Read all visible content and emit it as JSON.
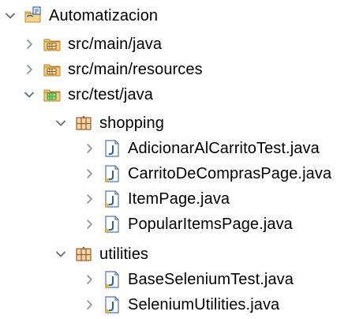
{
  "tree": {
    "project": {
      "label": "Automatizacion",
      "expanded": true,
      "icon": "java-project-icon"
    },
    "source_folders": [
      {
        "label": "src/main/java",
        "expanded": false,
        "icon": "source-folder-icon"
      },
      {
        "label": "src/main/resources",
        "expanded": false,
        "icon": "source-folder-icon"
      },
      {
        "label": "src/test/java",
        "expanded": true,
        "icon": "test-source-folder-icon"
      }
    ],
    "packages": [
      {
        "label": "shopping",
        "expanded": true,
        "icon": "package-icon",
        "files": [
          {
            "label": "AdicionarAlCarritoTest.java",
            "icon": "java-file-icon"
          },
          {
            "label": "CarritoDeComprasPage.java",
            "icon": "java-file-icon"
          },
          {
            "label": "ItemPage.java",
            "icon": "java-file-icon"
          },
          {
            "label": "PopularItemsPage.java",
            "icon": "java-file-icon"
          }
        ]
      },
      {
        "label": "utilities",
        "expanded": true,
        "icon": "package-icon",
        "files": [
          {
            "label": "BaseSeleniumTest.java",
            "icon": "java-file-icon"
          },
          {
            "label": "SeleniumUtilities.java",
            "icon": "java-file-icon"
          }
        ]
      }
    ]
  },
  "colors": {
    "chevron": "#5f6b78",
    "folder": "#e2a93b",
    "package_brown": "#9b5b2e",
    "java_blue": "#2d5fa6",
    "test_green": "#3a9d3a"
  }
}
